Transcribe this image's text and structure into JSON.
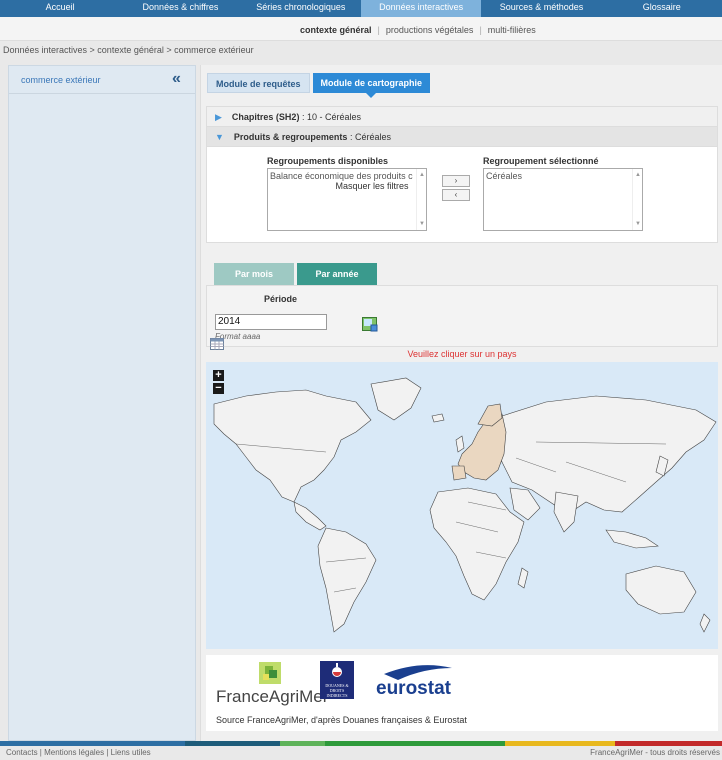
{
  "topnav": {
    "tabs": [
      "Accueil",
      "Données & chiffres",
      "Séries chronologiques",
      "Données interactives",
      "Sources & méthodes",
      "Glossaire"
    ],
    "active_index": 3
  },
  "subnav": {
    "items": [
      "contexte général",
      "productions végétales",
      "multi-filières"
    ],
    "separator": "|"
  },
  "breadcrumb": "Données interactives > contexte général > commerce extérieur",
  "sidebar": {
    "link": "commerce extérieur",
    "collapse_icon": "double-chevron-left-icon"
  },
  "tabs": {
    "requetes": "Module de requêtes",
    "cartographie": "Module de cartographie"
  },
  "filters": {
    "chapitres_label": "Chapitres (SH2)",
    "chapitres_value": " : 10 - Céréales",
    "produits_label": "Produits & regroupements",
    "produits_value": " : Céréales",
    "dispo_label": "Regroupements disponibles",
    "dispo_items": [
      "Balance économique des produits c"
    ],
    "selected_label": "Regroupement sélectionné",
    "selected_items": [
      "Céréales"
    ],
    "move_right": "›",
    "move_left": "‹",
    "hide_filters": "Masquer les filtres"
  },
  "periode_tabs": {
    "mois": "Par mois",
    "annee": "Par année"
  },
  "periode": {
    "label": "Période",
    "value": "2014",
    "format_hint": "Format aaaa"
  },
  "map": {
    "prompt": "Veuillez cliquer sur un pays",
    "zoom_in": "+",
    "zoom_out": "−",
    "ocean_color": "#d9e9f7",
    "land_color": "#f2f2f2",
    "highlight_color": "#ead7c1"
  },
  "logos": {
    "franceagrimer": "FranceAgriMer",
    "douanes": "DOUANES & DROITS INDIRECTS",
    "eurostat": "eurostat",
    "source": "Source FranceAgriMer, d'après Douanes françaises & Eurostat"
  },
  "footer": {
    "links": "Contacts | Mentions légales | Liens utiles",
    "copyright": "FranceAgriMer - tous droits réservés"
  }
}
